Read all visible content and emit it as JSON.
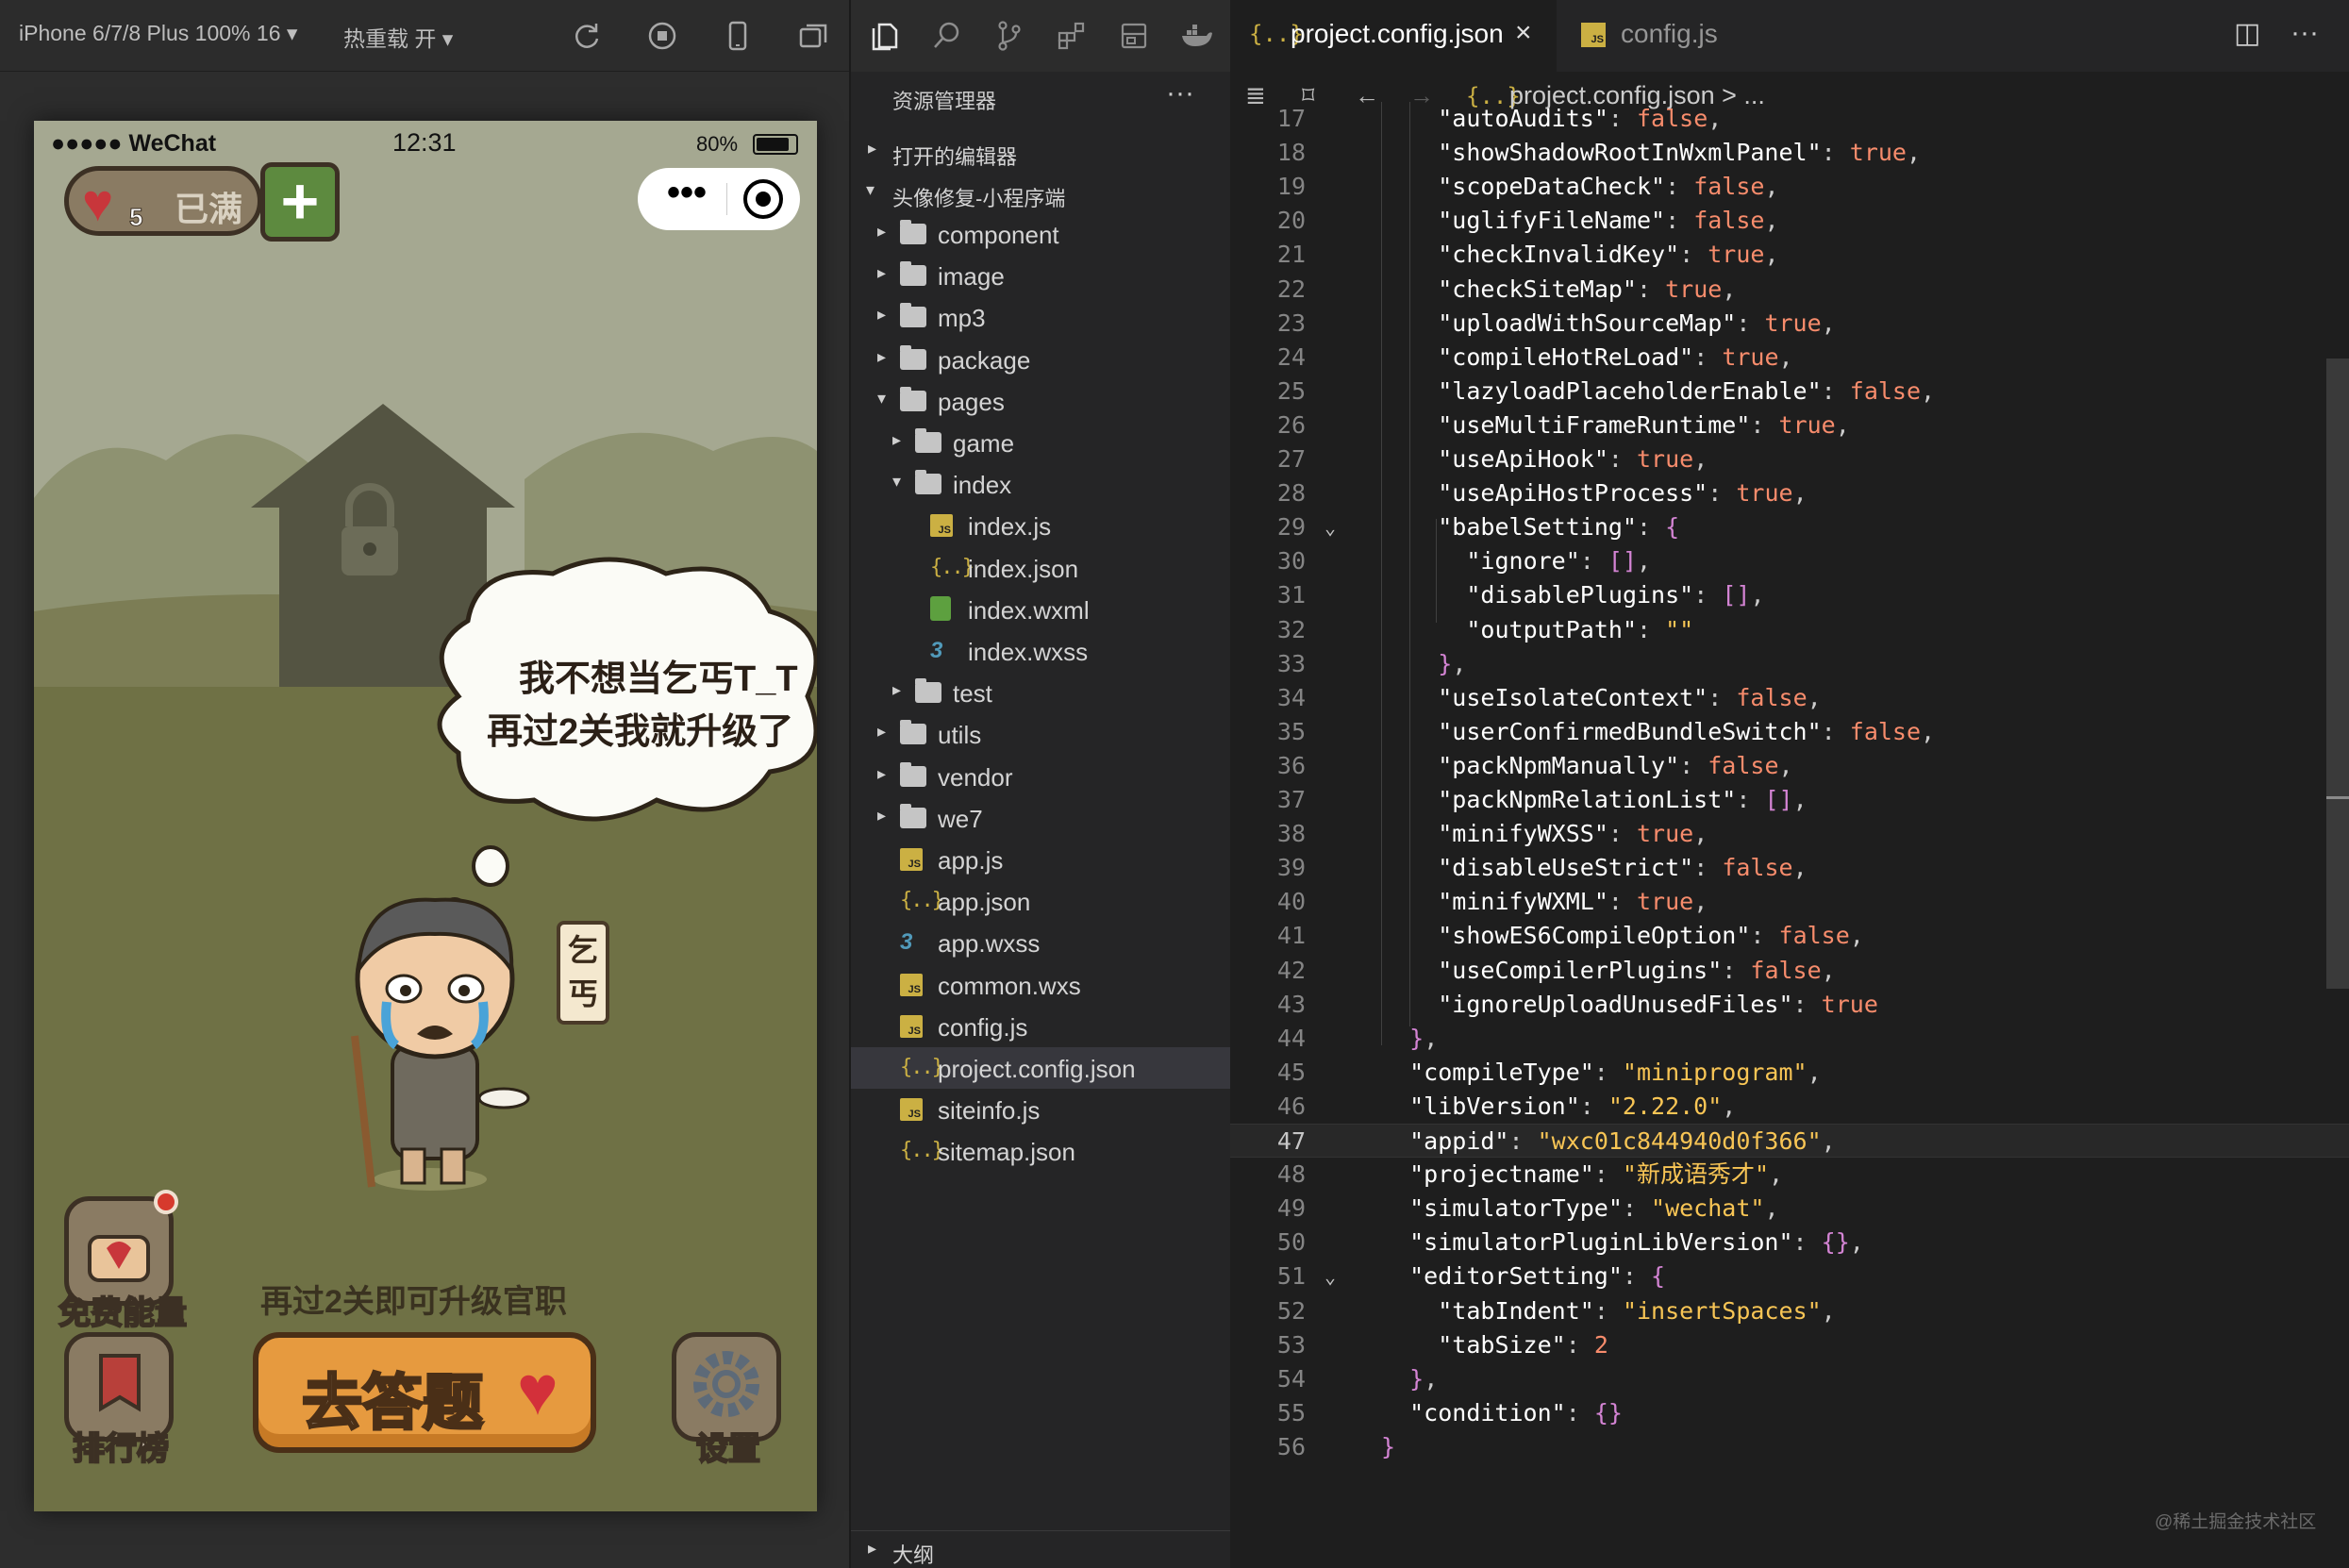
{
  "simulator": {
    "device": "iPhone 6/7/8 Plus 100% 16",
    "hot_reload": "热重载 开",
    "status": {
      "carrier": "●●●●● WeChat",
      "time": "12:31",
      "battery": "80%"
    },
    "energy": {
      "count": "5",
      "label": "已满"
    },
    "bubble": {
      "line1": "我不想当乞丐T_T",
      "line2": "再过2关我就升级了"
    },
    "tag": "乞丐",
    "free_energy": "免费能量",
    "rank": "排行榜",
    "settings": "设置",
    "level_tip": "再过2关即可升级官职",
    "go_answer": "去答题"
  },
  "explorer": {
    "title": "资源管理器",
    "open_editors": "打开的编辑器",
    "project": "头像修复-小程序端",
    "items": [
      {
        "label": "component",
        "type": "folder",
        "depth": 1,
        "chevron": "right"
      },
      {
        "label": "image",
        "type": "folder",
        "depth": 1,
        "chevron": "right"
      },
      {
        "label": "mp3",
        "type": "folder",
        "depth": 1,
        "chevron": "right"
      },
      {
        "label": "package",
        "type": "folder",
        "depth": 1,
        "chevron": "right"
      },
      {
        "label": "pages",
        "type": "folder",
        "depth": 1,
        "chevron": "down"
      },
      {
        "label": "game",
        "type": "folder",
        "depth": 2,
        "chevron": "right"
      },
      {
        "label": "index",
        "type": "folder",
        "depth": 2,
        "chevron": "down"
      },
      {
        "label": "index.js",
        "type": "js",
        "depth": 3
      },
      {
        "label": "index.json",
        "type": "json",
        "depth": 3
      },
      {
        "label": "index.wxml",
        "type": "wxml",
        "depth": 3
      },
      {
        "label": "index.wxss",
        "type": "css",
        "depth": 3
      },
      {
        "label": "test",
        "type": "folder",
        "depth": 2,
        "chevron": "right"
      },
      {
        "label": "utils",
        "type": "folder",
        "depth": 1,
        "chevron": "right"
      },
      {
        "label": "vendor",
        "type": "folder",
        "depth": 1,
        "chevron": "right"
      },
      {
        "label": "we7",
        "type": "folder",
        "depth": 1,
        "chevron": "right"
      },
      {
        "label": "app.js",
        "type": "js",
        "depth": 1
      },
      {
        "label": "app.json",
        "type": "json",
        "depth": 1
      },
      {
        "label": "app.wxss",
        "type": "css",
        "depth": 1
      },
      {
        "label": "common.wxs",
        "type": "js",
        "depth": 1
      },
      {
        "label": "config.js",
        "type": "js",
        "depth": 1
      },
      {
        "label": "project.config.json",
        "type": "json",
        "depth": 1,
        "selected": true
      },
      {
        "label": "siteinfo.js",
        "type": "js",
        "depth": 1
      },
      {
        "label": "sitemap.json",
        "type": "json",
        "depth": 1
      }
    ],
    "outline": "大纲"
  },
  "editor": {
    "tabs": [
      {
        "label": "project.config.json",
        "active": true
      },
      {
        "label": "config.js",
        "active": false
      }
    ],
    "breadcrumb": "project.config.json > ...",
    "current_line": 47,
    "lines": [
      {
        "n": "17",
        "t": "    \"autoAudits\": false,"
      },
      {
        "n": "18",
        "t": "    \"showShadowRootInWxmlPanel\": true,"
      },
      {
        "n": "19",
        "t": "    \"scopeDataCheck\": false,"
      },
      {
        "n": "20",
        "t": "    \"uglifyFileName\": false,"
      },
      {
        "n": "21",
        "t": "    \"checkInvalidKey\": true,"
      },
      {
        "n": "22",
        "t": "    \"checkSiteMap\": true,"
      },
      {
        "n": "23",
        "t": "    \"uploadWithSourceMap\": true,"
      },
      {
        "n": "24",
        "t": "    \"compileHotReLoad\": true,"
      },
      {
        "n": "25",
        "t": "    \"lazyloadPlaceholderEnable\": false,"
      },
      {
        "n": "26",
        "t": "    \"useMultiFrameRuntime\": true,"
      },
      {
        "n": "27",
        "t": "    \"useApiHook\": true,"
      },
      {
        "n": "28",
        "t": "    \"useApiHostProcess\": true,"
      },
      {
        "n": "29",
        "t": "    \"babelSetting\": {",
        "fold": true
      },
      {
        "n": "30",
        "t": "      \"ignore\": [],"
      },
      {
        "n": "31",
        "t": "      \"disablePlugins\": [],"
      },
      {
        "n": "32",
        "t": "      \"outputPath\": \"\""
      },
      {
        "n": "33",
        "t": "    },"
      },
      {
        "n": "34",
        "t": "    \"useIsolateContext\": false,"
      },
      {
        "n": "35",
        "t": "    \"userConfirmedBundleSwitch\": false,"
      },
      {
        "n": "36",
        "t": "    \"packNpmManually\": false,"
      },
      {
        "n": "37",
        "t": "    \"packNpmRelationList\": [],"
      },
      {
        "n": "38",
        "t": "    \"minifyWXSS\": true,"
      },
      {
        "n": "39",
        "t": "    \"disableUseStrict\": false,"
      },
      {
        "n": "40",
        "t": "    \"minifyWXML\": true,"
      },
      {
        "n": "41",
        "t": "    \"showES6CompileOption\": false,"
      },
      {
        "n": "42",
        "t": "    \"useCompilerPlugins\": false,"
      },
      {
        "n": "43",
        "t": "    \"ignoreUploadUnusedFiles\": true"
      },
      {
        "n": "44",
        "t": "  },"
      },
      {
        "n": "45",
        "t": "  \"compileType\": \"miniprogram\","
      },
      {
        "n": "46",
        "t": "  \"libVersion\": \"2.22.0\","
      },
      {
        "n": "47",
        "t": "  \"appid\": \"wxc01c844940d0f366\","
      },
      {
        "n": "48",
        "t": "  \"projectname\": \"新成语秀才\","
      },
      {
        "n": "49",
        "t": "  \"simulatorType\": \"wechat\","
      },
      {
        "n": "50",
        "t": "  \"simulatorPluginLibVersion\": {},"
      },
      {
        "n": "51",
        "t": "  \"editorSetting\": {",
        "fold": true
      },
      {
        "n": "52",
        "t": "    \"tabIndent\": \"insertSpaces\","
      },
      {
        "n": "53",
        "t": "    \"tabSize\": 2"
      },
      {
        "n": "54",
        "t": "  },"
      },
      {
        "n": "55",
        "t": "  \"condition\": {}"
      },
      {
        "n": "56",
        "t": "}"
      }
    ]
  },
  "watermark": "@稀土掘金技术社区"
}
